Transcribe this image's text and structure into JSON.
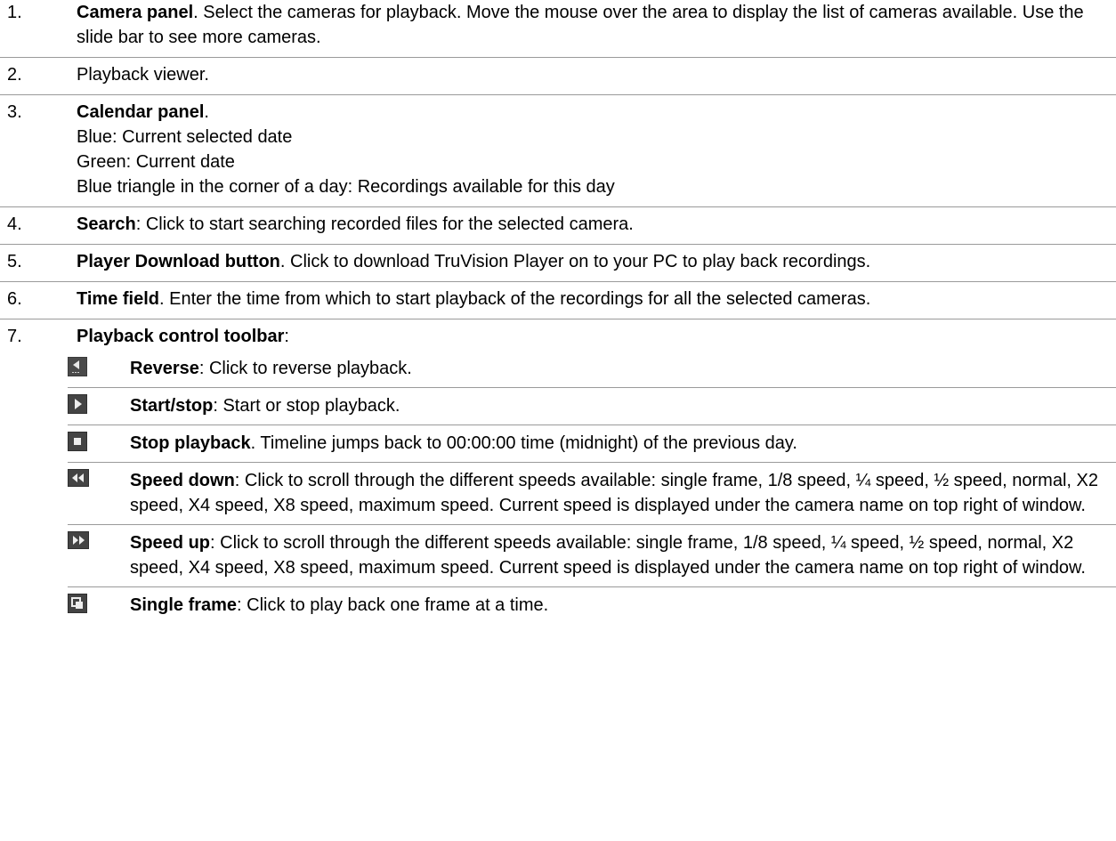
{
  "items": [
    {
      "num": "1.",
      "title": "Camera panel",
      "sep": ".",
      "text": " Select the cameras for playback. Move the mouse over the area to display the list of cameras available. Use the slide bar to see more cameras."
    },
    {
      "num": "2.",
      "text": "Playback viewer."
    },
    {
      "num": "3.",
      "title": "Calendar panel",
      "sep": ".",
      "lines": [
        "Blue: Current selected date",
        "Green: Current date",
        "Blue triangle in the corner of a day: Recordings available for this day"
      ]
    },
    {
      "num": "4.",
      "title": "Search",
      "sep": ":",
      "text": " Click to start searching recorded files for the selected camera."
    },
    {
      "num": "5.",
      "title": "Player Download button",
      "sep": ".",
      "text": " Click to download TruVision Player on to your PC to play back recordings."
    },
    {
      "num": "6.",
      "title": "Time field",
      "sep": ".",
      "text": " Enter the time from which to start playback of the recordings for all the selected cameras."
    },
    {
      "num": "7.",
      "title": "Playback control toolbar",
      "sep": ":"
    }
  ],
  "toolbar": [
    {
      "icon": "reverse-icon",
      "title": "Reverse",
      "sep": ":",
      "text": " Click to reverse playback."
    },
    {
      "icon": "play-icon",
      "title": "Start/stop",
      "sep": ":",
      "text": " Start or stop playback."
    },
    {
      "icon": "stop-icon",
      "title": "Stop playback",
      "sep": ".",
      "text": " Timeline jumps back to 00:00:00 time (midnight) of the previous day."
    },
    {
      "icon": "speed-down-icon",
      "title": "Speed down",
      "sep": ":",
      "text": " Click to scroll through the different speeds available: single frame, 1/8 speed, ¼  speed, ½ speed, normal, X2 speed, X4 speed, X8 speed, maximum speed. Current speed is displayed under the camera name on top right of window."
    },
    {
      "icon": "speed-up-icon",
      "title": "Speed up",
      "sep": ":",
      "text": " Click to scroll through the different speeds available: single frame, 1/8 speed, ¼ speed, ½ speed, normal, X2 speed, X4 speed, X8 speed, maximum speed. Current speed is displayed under the camera name on top right of window."
    },
    {
      "icon": "single-frame-icon",
      "title": "Single frame",
      "sep": ":",
      "text": " Click to play back one frame at a time."
    }
  ]
}
